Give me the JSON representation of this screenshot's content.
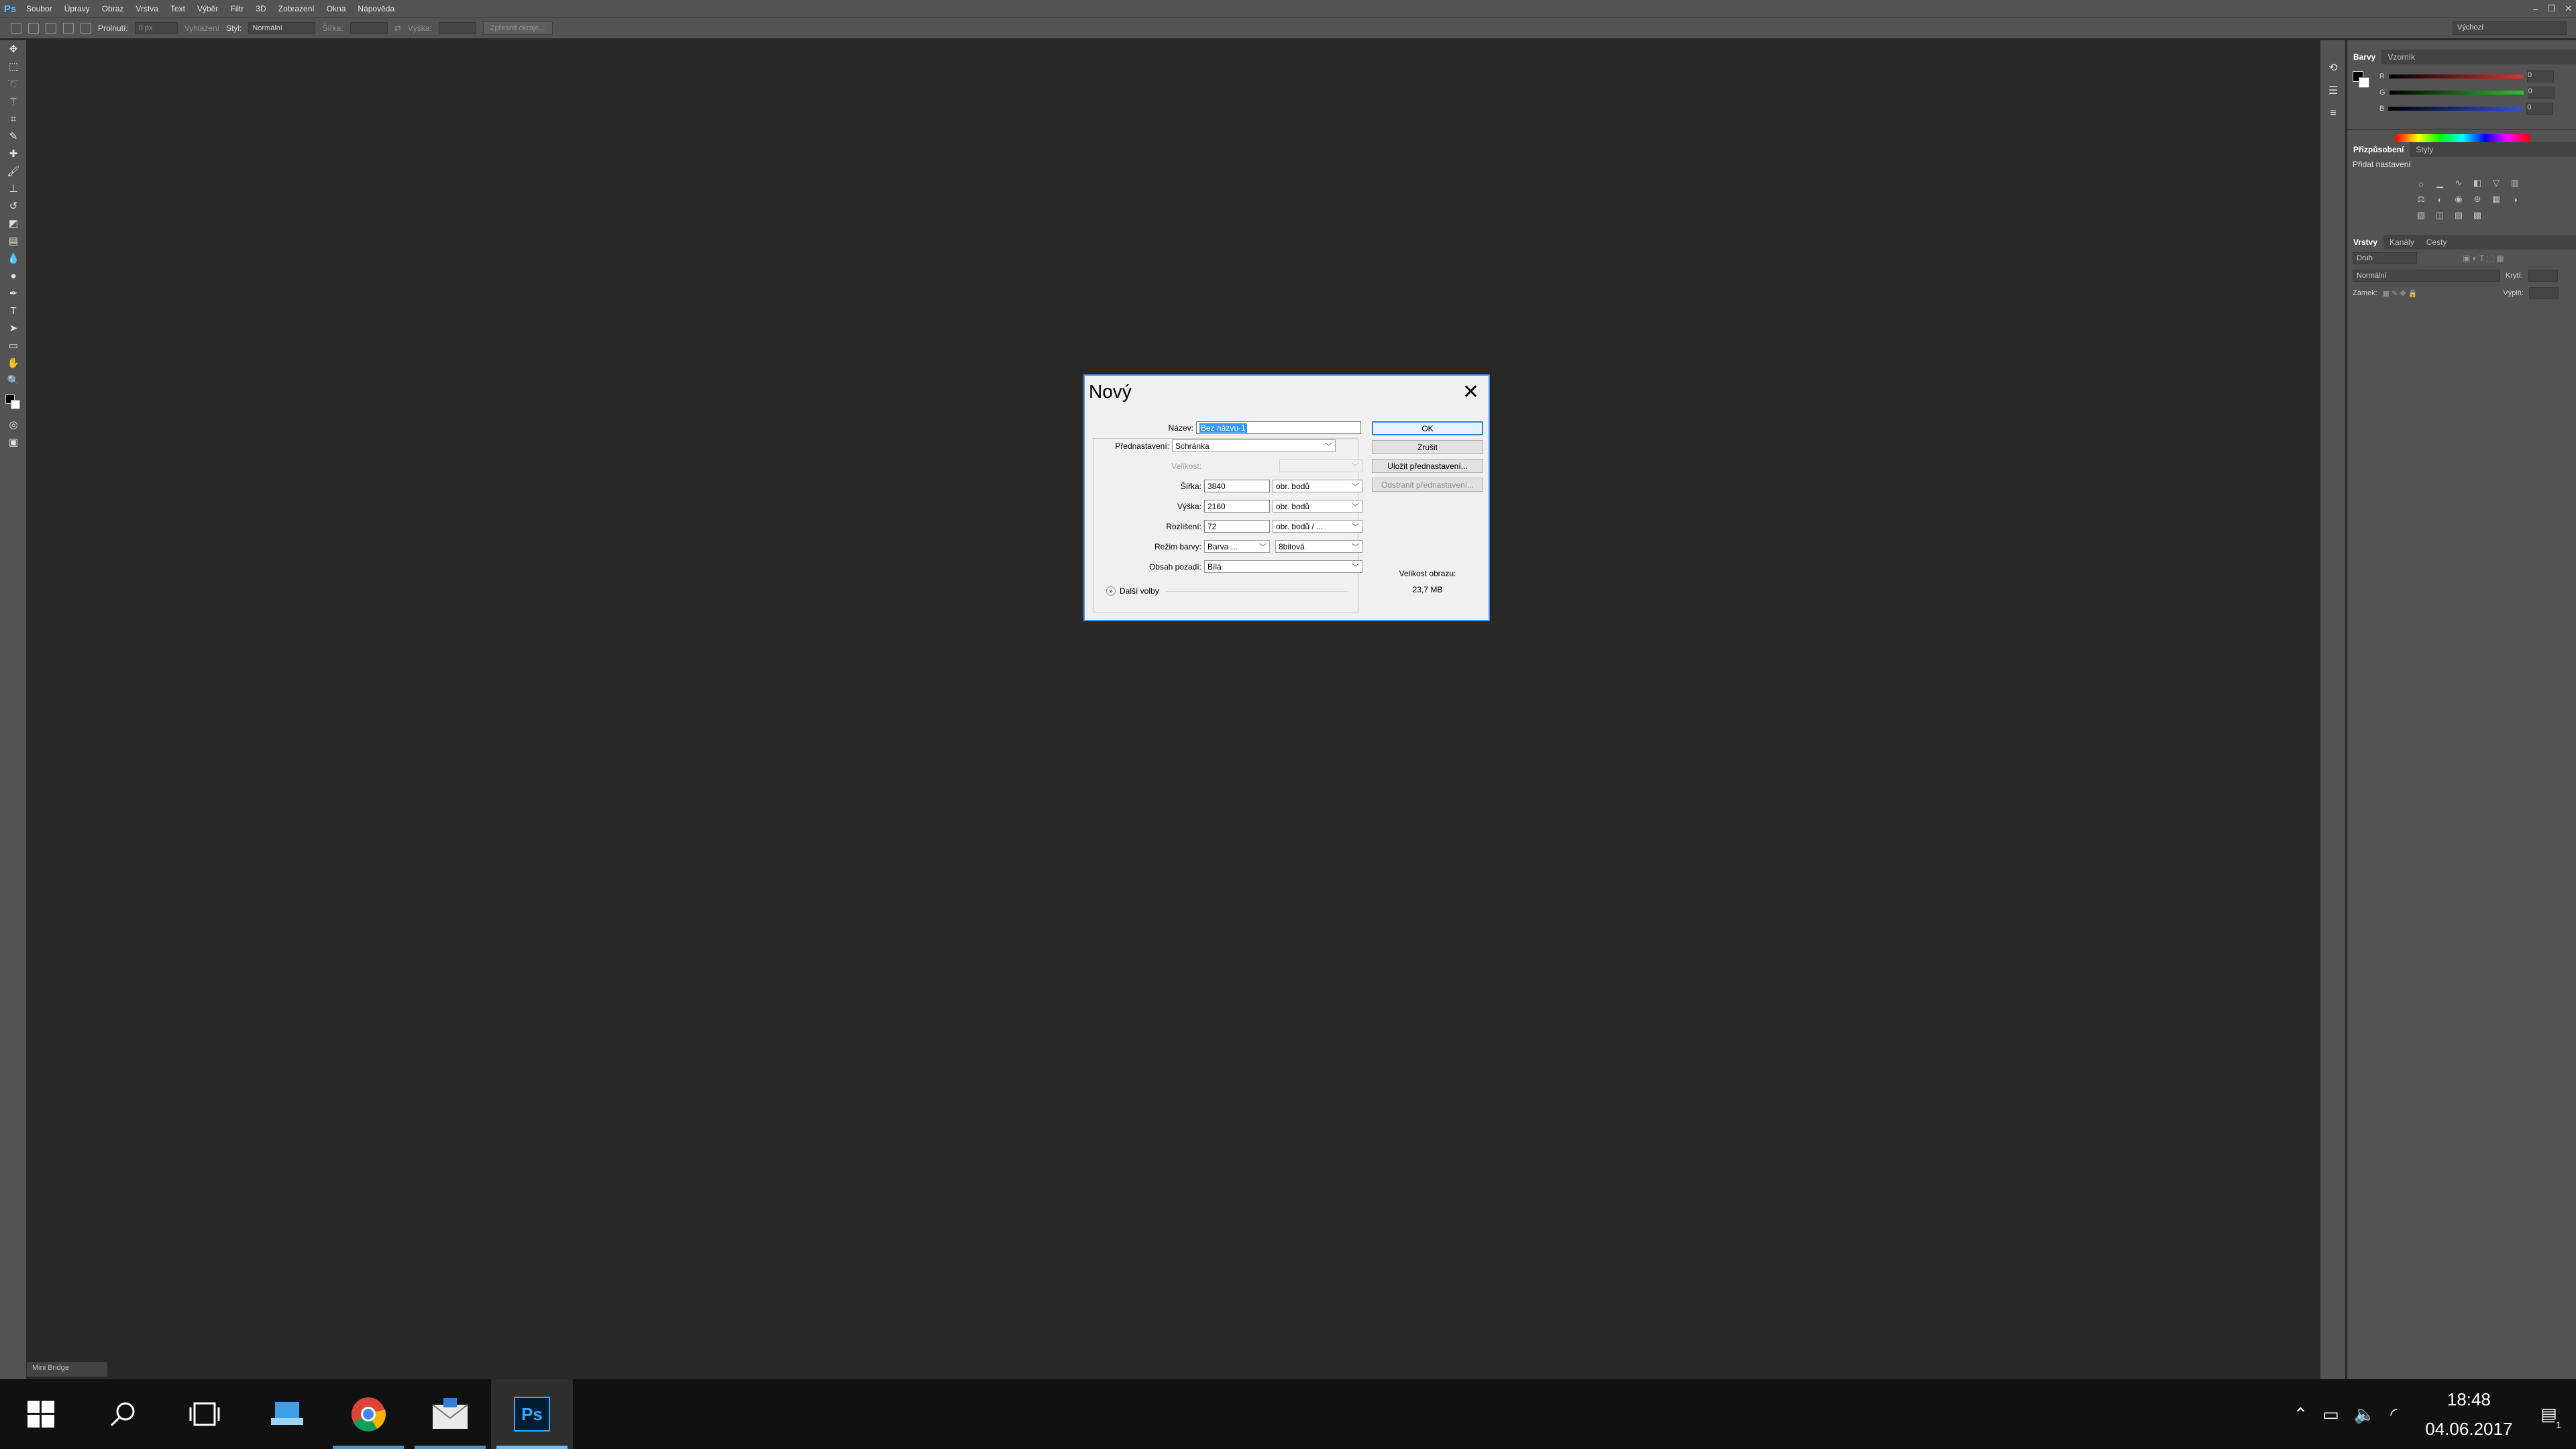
{
  "app": {
    "logo": "Ps",
    "menu": [
      "Soubor",
      "Úpravy",
      "Obraz",
      "Vrstva",
      "Text",
      "Výběr",
      "Filtr",
      "3D",
      "Zobrazení",
      "Okna",
      "Nápověda"
    ],
    "window_controls": [
      "–",
      "❐",
      "✕"
    ]
  },
  "options_bar": {
    "feather_label": "Prolnutí:",
    "feather_value": "0 px",
    "antialias_label": "Vyhlazení",
    "style_label": "Styl:",
    "style_value": "Normální",
    "width_label": "Šířka:",
    "height_label": "Výška:",
    "refine_button": "Zpřesnit okraje...",
    "workspace": "Výchozí"
  },
  "panels": {
    "color": {
      "tabs": [
        "Barvy",
        "Vzorník"
      ],
      "channels": [
        "R",
        "G",
        "B"
      ],
      "values": [
        "0",
        "0",
        "0"
      ],
      "accent": {
        "R": "#e03030",
        "G": "#30c030",
        "B": "#3050e0"
      }
    },
    "adjustments": {
      "tabs": [
        "Přizpůsobení",
        "Styly"
      ],
      "heading": "Přidat nastavení"
    },
    "layers": {
      "tabs": [
        "Vrstvy",
        "Kanály",
        "Cesty"
      ],
      "kind": "Druh",
      "blend": "Normální",
      "opacity_label": "Krytí:",
      "lock_label": "Zámek:",
      "fill_label": "Výplň:"
    }
  },
  "mini_panel": {
    "tab": "Mini Bridge"
  },
  "dialog": {
    "title": "Nový",
    "name_label": "Název:",
    "name_value": "Bez názvu-1",
    "preset_label": "Přednastavení:",
    "preset_value": "Schránka",
    "size_label": "Velikost:",
    "width_label": "Šířka:",
    "width_value": "3840",
    "width_unit": "obr. bodů",
    "height_label": "Výška:",
    "height_value": "2160",
    "height_unit": "obr. bodů",
    "resolution_label": "Rozlišení:",
    "resolution_value": "72",
    "resolution_unit": "obr. bodů / ...",
    "colormode_label": "Režim barvy:",
    "colormode_value": "Barva ...",
    "bitdepth_value": "8bitová",
    "background_label": "Obsah pozadí:",
    "background_value": "Bílá",
    "advanced_label": "Další volby",
    "ok_button": "OK",
    "cancel_button": "Zrušit",
    "save_preset_button": "Uložit přednastavení...",
    "delete_preset_button": "Odstranit přednastavení...",
    "image_size_label": "Velikost obrazu:",
    "image_size_value": "23,7 MB"
  },
  "taskbar": {
    "time": "18:48",
    "date": "04.06.2017",
    "notifications": "1"
  }
}
